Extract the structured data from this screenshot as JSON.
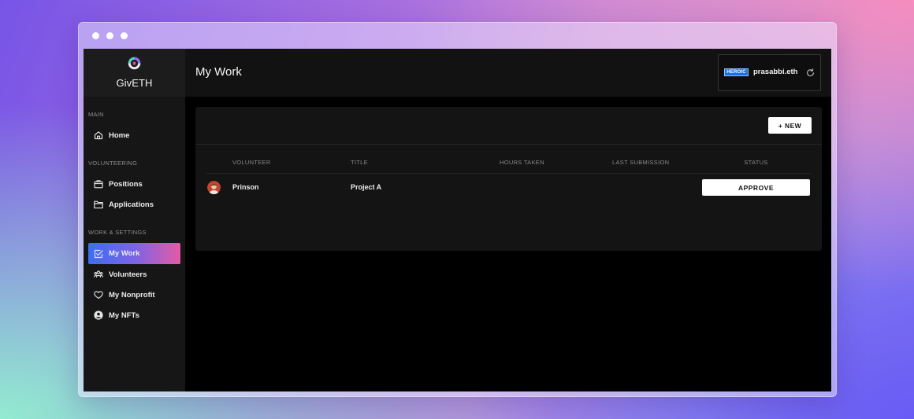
{
  "brand": {
    "name": "GivETH",
    "logo_icon": "giveth-logo-icon"
  },
  "header": {
    "title": "My Work"
  },
  "wallet": {
    "badge": "HEROIC",
    "address": "prasabbi.eth",
    "refresh_icon": "refresh-icon"
  },
  "sidebar": {
    "sections": [
      {
        "label": "MAIN",
        "items": [
          {
            "label": "Home",
            "icon": "home-icon",
            "active": false
          }
        ]
      },
      {
        "label": "VOLUNTEERING",
        "items": [
          {
            "label": "Positions",
            "icon": "briefcase-icon",
            "active": false
          },
          {
            "label": "Applications",
            "icon": "folder-icon",
            "active": false
          }
        ]
      },
      {
        "label": "WORK & SETTINGS",
        "items": [
          {
            "label": "My Work",
            "icon": "check-square-icon",
            "active": true
          },
          {
            "label": "Volunteers",
            "icon": "users-icon",
            "active": false
          },
          {
            "label": "My Nonprofit",
            "icon": "heart-icon",
            "active": false
          },
          {
            "label": "My NFTs",
            "icon": "user-circle-icon",
            "active": false
          }
        ]
      }
    ]
  },
  "main": {
    "new_button": "+ NEW",
    "table": {
      "columns": [
        "VOLUNTEER",
        "TITLE",
        "HOURS TAKEN",
        "LAST SUBMISSION",
        "STATUS"
      ],
      "rows": [
        {
          "volunteer": "Prinson",
          "title": "Project A",
          "action": "APPROVE"
        }
      ]
    }
  },
  "colors": {
    "accent_start": "#3b6ef5",
    "accent_end": "#e65aa6",
    "badge_blue": "#1f6fe5",
    "sidebar_bg": "#161616",
    "card_bg": "#141414",
    "page_bg": "#000000"
  }
}
